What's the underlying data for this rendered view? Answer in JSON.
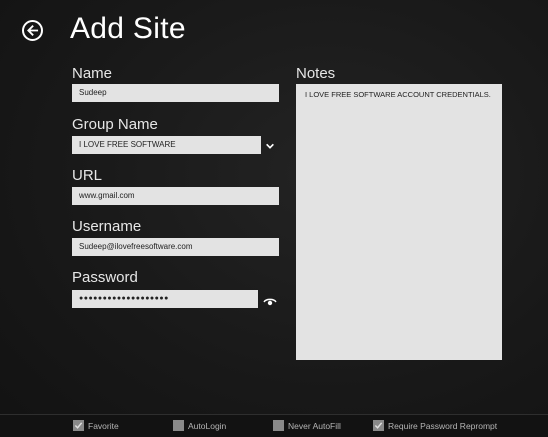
{
  "header": {
    "title": "Add Site"
  },
  "form": {
    "name": {
      "label": "Name",
      "value": "Sudeep"
    },
    "group": {
      "label": "Group Name",
      "value": "I LOVE FREE SOFTWARE"
    },
    "url": {
      "label": "URL",
      "value": "www.gmail.com"
    },
    "username": {
      "label": "Username",
      "value": "Sudeep@ilovefreesoftware.com"
    },
    "password": {
      "label": "Password",
      "value": "●●●●●●●●●●●●●●●●●●●"
    },
    "notes": {
      "label": "Notes",
      "value": "I LOVE FREE SOFTWARE ACCOUNT CREDENTIALS."
    }
  },
  "options": [
    {
      "label": "Favorite",
      "checked": true
    },
    {
      "label": "AutoLogin",
      "checked": false
    },
    {
      "label": "Never AutoFill",
      "checked": false
    },
    {
      "label": "Require Password Reprompt",
      "checked": true
    }
  ],
  "icons": {
    "back": "back-arrow-icon",
    "dropdown": "chevron-down-icon",
    "reveal": "eye-icon",
    "check": "checkmark-icon"
  }
}
